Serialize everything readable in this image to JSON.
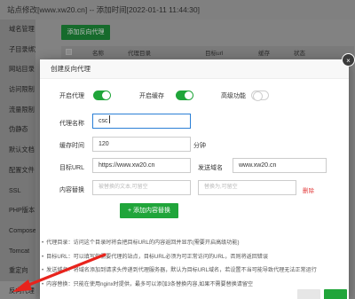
{
  "window": {
    "title": "站点修改[www.xw20.cn] -- 添加时间[2022-01-11 11:44:30]"
  },
  "sidebar": {
    "items": [
      {
        "label": "域名管理"
      },
      {
        "label": "子目录绑定"
      },
      {
        "label": "网站目录"
      },
      {
        "label": "访问限制"
      },
      {
        "label": "流量限制"
      },
      {
        "label": "伪静态"
      },
      {
        "label": "默认文档"
      },
      {
        "label": "配置文件"
      },
      {
        "label": "SSL"
      },
      {
        "label": "PHP版本"
      },
      {
        "label": "Composer"
      },
      {
        "label": "Tomcat"
      },
      {
        "label": "重定向"
      },
      {
        "label": "反向代理"
      }
    ]
  },
  "background": {
    "add_button": "添加反向代理",
    "columns": [
      "名称",
      "代理目录",
      "目标url",
      "缓存",
      "状态"
    ]
  },
  "dialog": {
    "title": "创建反向代理",
    "close_glyph": "×",
    "enable_proxy_label": "开启代理",
    "enable_proxy": true,
    "enable_cache_label": "开启缓存",
    "enable_cache": true,
    "advanced_label": "高级功能",
    "advanced": false,
    "proxy_name_label": "代理名称",
    "proxy_name_value": "csc",
    "cache_time_label": "缓存时间",
    "cache_time_value": "120",
    "cache_time_unit": "分钟",
    "target_url_label": "目标URL",
    "target_url_value": "https://www.xw20.cn",
    "send_domain_label": "发送域名",
    "send_domain_value": "www.xw20.cn",
    "content_replace_label": "内容替换",
    "replace_from_placeholder": "被替换的文本,可留空",
    "replace_to_placeholder": "替换为,可留空",
    "delete_label": "删除",
    "add_replace_button": "+ 添加内容替换",
    "notes": [
      "代理目录：访问这个目录时将会把目标URL的内容返回并显示(需要开启高级功能)",
      "目标URL：可以填写你需要代理的站点，目标URL必须为可正常访问的URL，否则将返回错误",
      "发送域名：将域名添加到请求头传递到代理服务器，默认为目标URL域名，若设置不当可能导致代理无法正常运行",
      "内容替换：只能在使用nginx时提供，最多可以添加3条替换内容,如果不需要替换请留空"
    ]
  },
  "colors": {
    "accent_green": "#20a53a",
    "focus_blue": "#2b7fd6",
    "delete_red": "#e23b3b",
    "arrow_red": "#e8231c"
  }
}
